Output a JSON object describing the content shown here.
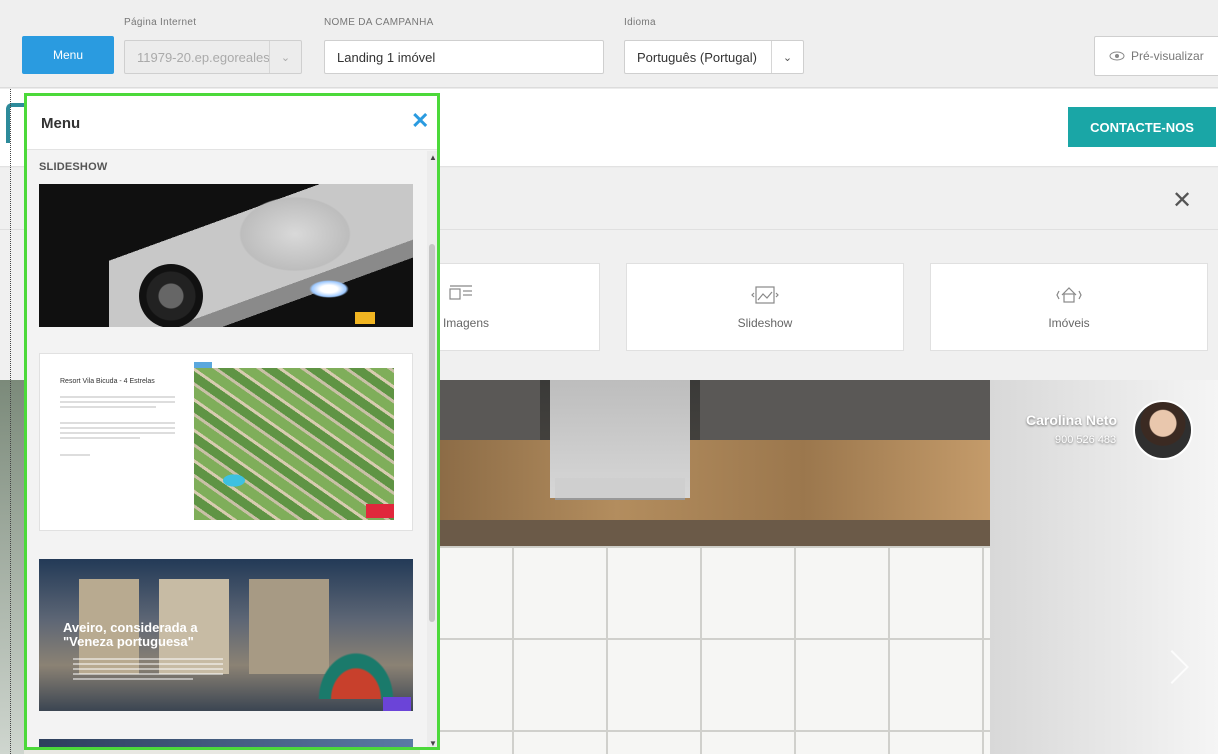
{
  "toolbar": {
    "menu_button": "Menu",
    "website": {
      "label": "Página Internet",
      "value": "11979-20.ep.egoreales"
    },
    "campaign": {
      "label": "NOME DA CAMPANHA",
      "value": "Landing 1 imóvel"
    },
    "language": {
      "label": "Idioma",
      "value": "Português (Portugal)"
    },
    "preview_button": "Pré-visualizar"
  },
  "site": {
    "contact_button": "CONTACTE-NOS",
    "picker_cards": [
      {
        "label": "e Imagens",
        "icon": "text-image-icon"
      },
      {
        "label": "Slideshow",
        "icon": "slideshow-icon"
      },
      {
        "label": "Imóveis",
        "icon": "house-icon"
      }
    ],
    "agent": {
      "name": "Carolina Neto",
      "phone": "900 526 483"
    }
  },
  "menu_panel": {
    "title": "Menu",
    "section": "SLIDESHOW",
    "thumb2": {
      "title": "Resort Vila Bicuda - 4 Estrelas"
    },
    "thumb3": {
      "headline": "Aveiro, considerada a \"Veneza portuguesa\""
    }
  },
  "colors": {
    "primary_blue": "#2a9be0",
    "teal": "#1aa6a6",
    "selection_green": "#4cd93a"
  }
}
